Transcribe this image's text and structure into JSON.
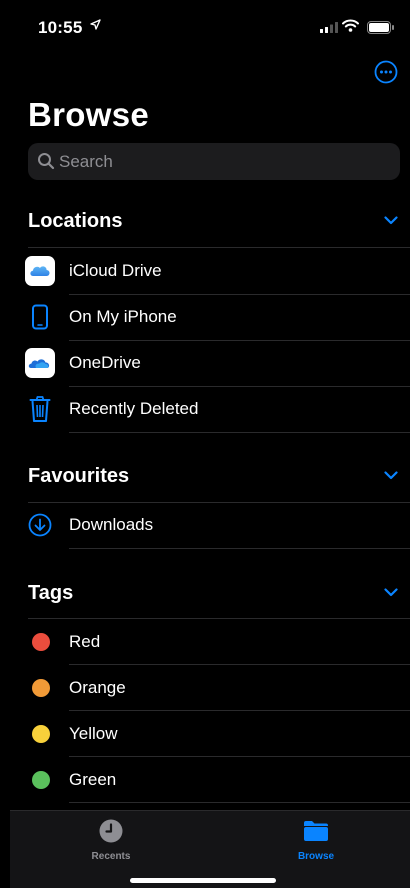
{
  "status_bar": {
    "time": "10:55"
  },
  "header": {
    "title": "Browse"
  },
  "search": {
    "placeholder": "Search"
  },
  "sections": {
    "locations": {
      "title": "Locations",
      "items": [
        {
          "label": "iCloud Drive",
          "icon": "icloud-icon"
        },
        {
          "label": "On My iPhone",
          "icon": "iphone-icon"
        },
        {
          "label": "OneDrive",
          "icon": "onedrive-icon"
        },
        {
          "label": "Recently Deleted",
          "icon": "trash-icon"
        }
      ]
    },
    "favourites": {
      "title": "Favourites",
      "items": [
        {
          "label": "Downloads",
          "icon": "download-circle-icon"
        }
      ]
    },
    "tags": {
      "title": "Tags",
      "items": [
        {
          "label": "Red",
          "color": "#eb4d3d"
        },
        {
          "label": "Orange",
          "color": "#f19a37"
        },
        {
          "label": "Yellow",
          "color": "#f8d13b"
        },
        {
          "label": "Green",
          "color": "#5ac05c"
        }
      ]
    }
  },
  "tab_bar": {
    "tabs": [
      {
        "label": "Recents",
        "icon": "clock-icon",
        "active": false
      },
      {
        "label": "Browse",
        "icon": "folder-icon",
        "active": true
      }
    ]
  },
  "colors": {
    "accent": "#0a84ff",
    "background": "#000000"
  }
}
